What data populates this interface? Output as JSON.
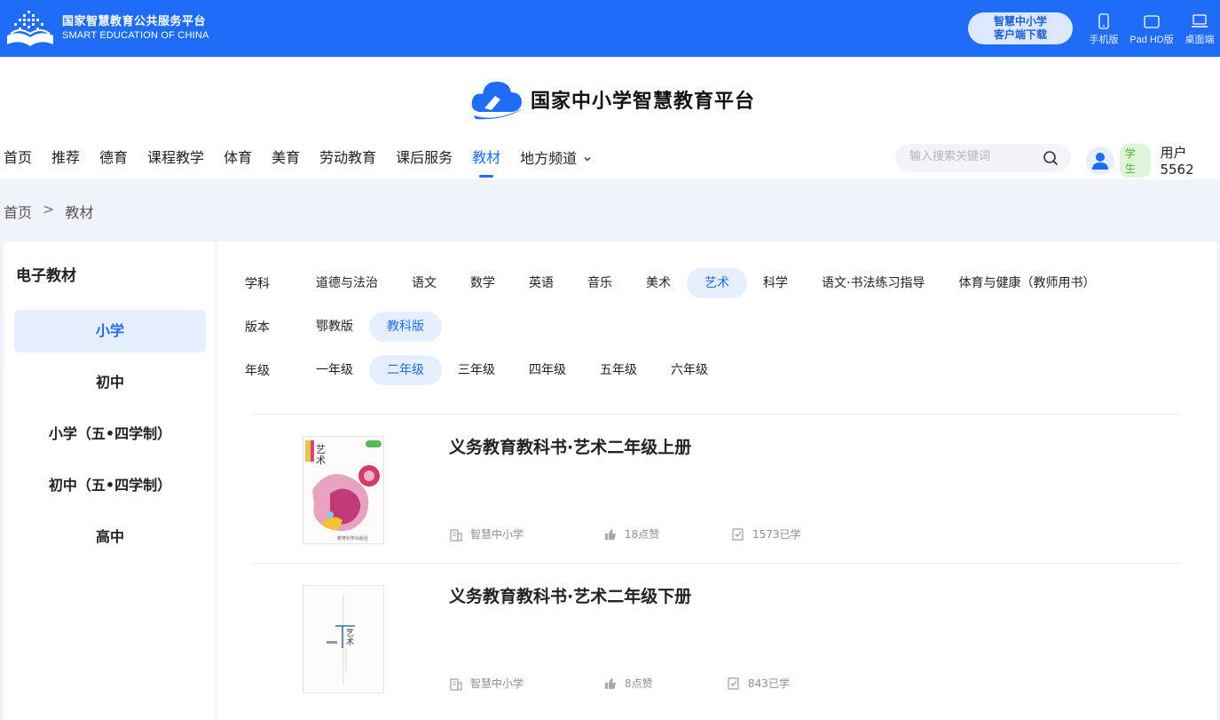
{
  "topbar": {
    "brand_cn": "国家智慧教育公共服务平台",
    "brand_en": "SMART EDUCATION OF CHINA",
    "download_line1": "智慧中小学",
    "download_line2": "客户端下载",
    "platforms": [
      {
        "label": "手机版",
        "icon": "phone-icon"
      },
      {
        "label": "Pad HD版",
        "icon": "tablet-icon"
      },
      {
        "label": "桌面端",
        "icon": "laptop-icon"
      }
    ]
  },
  "header": {
    "title": "国家中小学智慧教育平台",
    "nav": [
      "首页",
      "推荐",
      "德育",
      "课程教学",
      "体育",
      "美育",
      "劳动教育",
      "课后服务",
      "教材",
      "地方频道"
    ],
    "active_nav": "教材",
    "search_placeholder": "输入搜索关键词",
    "role": "学生",
    "username": "用户5562"
  },
  "breadcrumb": {
    "home": "首页",
    "sep": ">",
    "current": "教材"
  },
  "sidebar": {
    "title": "电子教材",
    "items": [
      "小学",
      "初中",
      "小学（五•四学制）",
      "初中（五•四学制）",
      "高中"
    ],
    "active": "小学"
  },
  "filters": {
    "subject_label": "学科",
    "subjects": [
      "道德与法治",
      "语文",
      "数学",
      "英语",
      "音乐",
      "美术",
      "艺术",
      "科学",
      "语文·书法练习指导",
      "体育与健康（教师用书）"
    ],
    "subject_active": "艺术",
    "edition_label": "版本",
    "editions": [
      "鄂教版",
      "教科版"
    ],
    "edition_active": "教科版",
    "grade_label": "年级",
    "grades": [
      "一年级",
      "二年级",
      "三年级",
      "四年级",
      "五年级",
      "六年级"
    ],
    "grade_active": "二年级"
  },
  "books": [
    {
      "title": "义务教育教科书·艺术二年级上册",
      "source": "智慧中小学",
      "likes": "18点赞",
      "learned": "1573已学"
    },
    {
      "title": "义务教育教科书·艺术二年级下册",
      "source": "智慧中小学",
      "likes": "8点赞",
      "learned": "843已学"
    }
  ],
  "colors": {
    "primary": "#1f6cf6",
    "active_bg": "#e6efff",
    "role_bg": "#dff5d9",
    "role_text": "#55b23b"
  }
}
